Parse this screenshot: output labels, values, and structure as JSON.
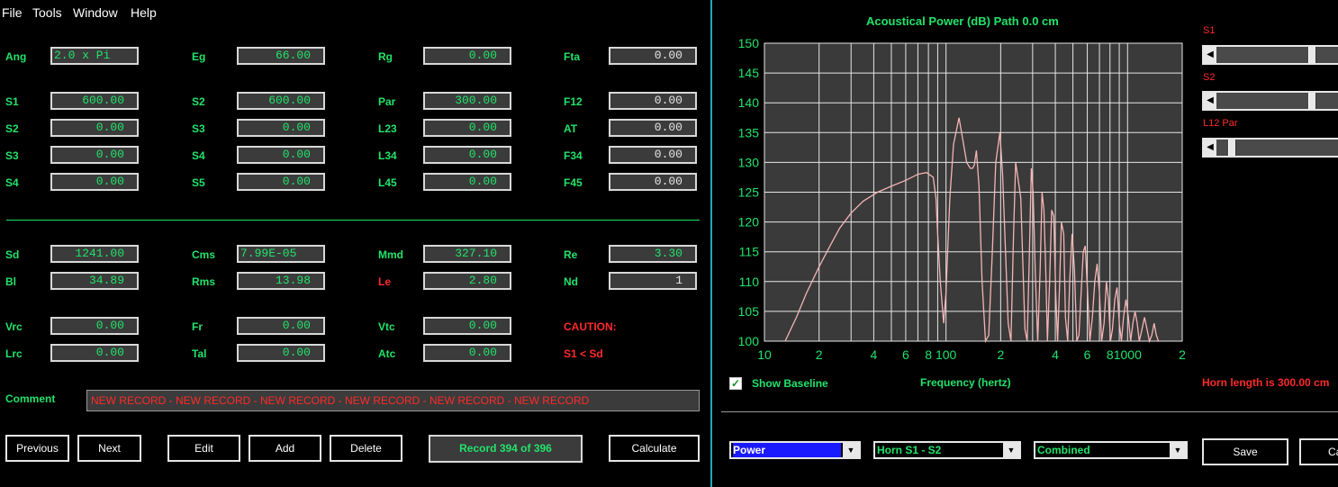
{
  "menu": [
    "File",
    "Tools",
    "Window",
    "Help"
  ],
  "params": {
    "ang": {
      "label": "Ang",
      "value": "2.0 x Pi"
    },
    "eg": {
      "label": "Eg",
      "value": "66.00"
    },
    "rg": {
      "label": "Rg",
      "value": "0.00"
    },
    "fta": {
      "label": "Fta",
      "value": "0.00"
    },
    "s1a": {
      "label": "S1",
      "value": "600.00"
    },
    "s2b": {
      "label": "S2",
      "value": "600.00"
    },
    "par": {
      "label": "Par",
      "value": "300.00"
    },
    "f12": {
      "label": "F12",
      "value": "0.00"
    },
    "s2a": {
      "label": "S2",
      "value": "0.00"
    },
    "s3b": {
      "label": "S3",
      "value": "0.00"
    },
    "l23": {
      "label": "L23",
      "value": "0.00"
    },
    "at": {
      "label": "AT",
      "value": "0.00"
    },
    "s3a": {
      "label": "S3",
      "value": "0.00"
    },
    "s4b": {
      "label": "S4",
      "value": "0.00"
    },
    "l34": {
      "label": "L34",
      "value": "0.00"
    },
    "f34": {
      "label": "F34",
      "value": "0.00"
    },
    "s4a": {
      "label": "S4",
      "value": "0.00"
    },
    "s5b": {
      "label": "S5",
      "value": "0.00"
    },
    "l45": {
      "label": "L45",
      "value": "0.00"
    },
    "f45": {
      "label": "F45",
      "value": "0.00"
    },
    "sd": {
      "label": "Sd",
      "value": "1241.00"
    },
    "cms": {
      "label": "Cms",
      "value": "7.99E-05"
    },
    "mmd": {
      "label": "Mmd",
      "value": "327.10"
    },
    "re": {
      "label": "Re",
      "value": "3.30"
    },
    "bl": {
      "label": "Bl",
      "value": "34.89"
    },
    "rms": {
      "label": "Rms",
      "value": "13.98"
    },
    "le": {
      "label": "Le",
      "value": "2.80"
    },
    "nd": {
      "label": "Nd",
      "value": "1"
    },
    "vrc": {
      "label": "Vrc",
      "value": "0.00"
    },
    "fr": {
      "label": "Fr",
      "value": "0.00"
    },
    "vtc": {
      "label": "Vtc",
      "value": "0.00"
    },
    "lrc": {
      "label": "Lrc",
      "value": "0.00"
    },
    "tal": {
      "label": "Tal",
      "value": "0.00"
    },
    "atc": {
      "label": "Atc",
      "value": "0.00"
    }
  },
  "caution": {
    "title": "CAUTION:",
    "message": "S1 < Sd"
  },
  "comment": {
    "label": "Comment",
    "value": "NEW RECORD - NEW RECORD - NEW RECORD - NEW RECORD - NEW RECORD - NEW RECORD"
  },
  "buttons": {
    "previous": "Previous",
    "next": "Next",
    "edit": "Edit",
    "add": "Add",
    "delete": "Delete",
    "calculate": "Calculate",
    "save": "Save",
    "cancel_partial": "Ca"
  },
  "record_status": "Record 394 of 396",
  "graph": {
    "title": "Acoustical Power (dB)   Path 0.0 cm",
    "xlabel": "Frequency (hertz)",
    "show_baseline_label": "Show Baseline",
    "show_baseline_checked": true,
    "horn_length": "Horn length is 300.00 cm",
    "sliders": [
      {
        "label": "S1",
        "level": 0.77
      },
      {
        "label": "S2",
        "level": 0.77
      },
      {
        "label": "L12  Par",
        "level": 0.1
      }
    ],
    "dropdowns": [
      "Power",
      "Horn S1 - S2",
      "Combined"
    ]
  },
  "colors": {
    "label_green": "#22e36b",
    "alert_red": "#ff2a2a",
    "curve": "#f5b4b4",
    "field_bg": "#3b3b3b",
    "dropdown_selected": "#1a1aff"
  },
  "chart_data": {
    "type": "line",
    "title": "Acoustical Power (dB)   Path 0.0 cm",
    "xlabel": "Frequency (hertz)",
    "ylabel": "",
    "xscale": "log",
    "xlim": [
      10,
      2000
    ],
    "ylim": [
      100,
      150
    ],
    "grid": true,
    "y_ticks": [
      100,
      105,
      110,
      115,
      120,
      125,
      130,
      135,
      140,
      145,
      150
    ],
    "x_tick_labels": [
      "10",
      "2",
      "4",
      "6",
      "8",
      "100",
      "2",
      "4",
      "6",
      "8",
      "1000",
      "2"
    ],
    "x": [
      13,
      15,
      17,
      20,
      23,
      26,
      30,
      35,
      42,
      50,
      60,
      70,
      78,
      85,
      88,
      90,
      93,
      97,
      100,
      105,
      110,
      118,
      125,
      130,
      136,
      140,
      143,
      147,
      152,
      158,
      165,
      172,
      180,
      188,
      198,
      205,
      212,
      220,
      228,
      235,
      242,
      250,
      258,
      265,
      272,
      280,
      287,
      295,
      302,
      310,
      320,
      330,
      338,
      346,
      354,
      362,
      372,
      382,
      392,
      402,
      412,
      422,
      432,
      445,
      455,
      468,
      480,
      495,
      510,
      525,
      540,
      555,
      570,
      585,
      600,
      620,
      640,
      660,
      680,
      700,
      720,
      742,
      765,
      785,
      805,
      825,
      850,
      875,
      900,
      925,
      950,
      980,
      1010,
      1040,
      1070,
      1100,
      1130,
      1160,
      1200,
      1240,
      1280,
      1320,
      1360,
      1400,
      1440,
      1480,
      1520
    ],
    "y": [
      100,
      104,
      108,
      112.5,
      116,
      119,
      121.5,
      123.5,
      125,
      126,
      127,
      128,
      128.3,
      127.5,
      124,
      118,
      110,
      103,
      108,
      124,
      133,
      137.5,
      133,
      130,
      129,
      129,
      129.5,
      132,
      126,
      110,
      100,
      101,
      115,
      130,
      135,
      128,
      116,
      103,
      100,
      117,
      130,
      127,
      124,
      113,
      102,
      100,
      113,
      129,
      125,
      112,
      100,
      112,
      125,
      122,
      112,
      100,
      110,
      122,
      121,
      108,
      100,
      109,
      120,
      118,
      104,
      100,
      110,
      118,
      112,
      100,
      101,
      108,
      115,
      116,
      109,
      100,
      104,
      110,
      113,
      108,
      100,
      103,
      110,
      107,
      100,
      102,
      107,
      109,
      103,
      100,
      104,
      107,
      104,
      100,
      103,
      105,
      103,
      100,
      102,
      104,
      102,
      100,
      101,
      103,
      101,
      100,
      100
    ]
  }
}
